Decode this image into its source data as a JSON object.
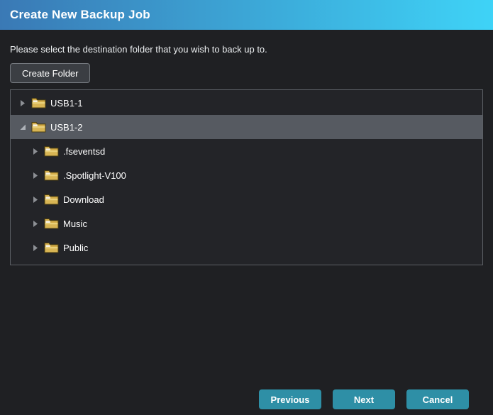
{
  "dialog": {
    "title": "Create New Backup Job",
    "instruction": "Please select the destination folder that you wish to back up to.",
    "create_folder_label": "Create Folder"
  },
  "tree": {
    "items": [
      {
        "label": "USB1-1",
        "level": 0,
        "state": "collapsed",
        "selected": false,
        "icon": "folder-icon"
      },
      {
        "label": "USB1-2",
        "level": 0,
        "state": "expanded",
        "selected": true,
        "icon": "folder-icon"
      },
      {
        "label": ".fseventsd",
        "level": 1,
        "state": "collapsed",
        "selected": false,
        "icon": "folder-icon"
      },
      {
        "label": ".Spotlight-V100",
        "level": 1,
        "state": "collapsed",
        "selected": false,
        "icon": "folder-icon"
      },
      {
        "label": "Download",
        "level": 1,
        "state": "collapsed",
        "selected": false,
        "icon": "folder-icon"
      },
      {
        "label": "Music",
        "level": 1,
        "state": "collapsed",
        "selected": false,
        "icon": "folder-icon"
      },
      {
        "label": "Public",
        "level": 1,
        "state": "collapsed",
        "selected": false,
        "icon": "folder-icon"
      }
    ]
  },
  "footer": {
    "previous_label": "Previous",
    "next_label": "Next",
    "cancel_label": "Cancel"
  },
  "colors": {
    "header_gradient_start": "#3a79b5",
    "header_gradient_end": "#3ed3f7",
    "background": "#1f2023",
    "panel_bg": "#232428",
    "panel_border": "#5c6065",
    "selected_row_bg": "#565a61",
    "primary_button_bg": "#2e8fa6",
    "secondary_button_bg": "#3b3e43",
    "secondary_button_border": "#75797f",
    "folder_icon_body": "#d2ac48",
    "folder_icon_highlight": "#e9d07a",
    "folder_icon_slot": "#f5f1e3",
    "expander_color": "#9b9fa6"
  }
}
